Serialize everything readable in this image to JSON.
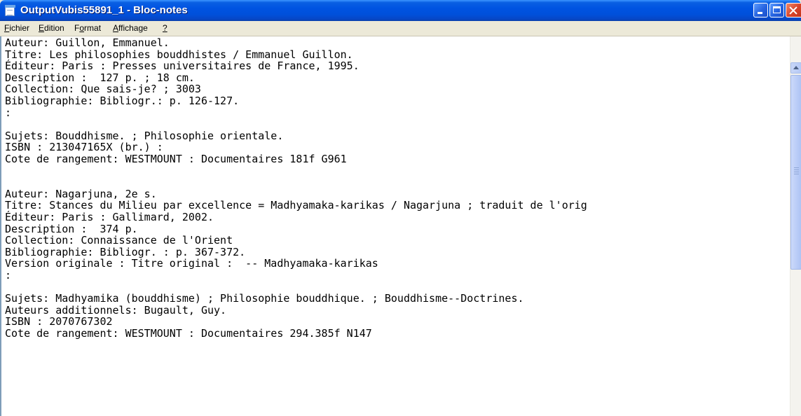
{
  "window": {
    "title": "OutputVubis55891_1 - Bloc-notes",
    "icon": "notepad-icon",
    "buttons": [
      "minimize-button",
      "maximize-button",
      "close-button"
    ]
  },
  "menu": {
    "items": [
      {
        "label": "Fichier",
        "mnemonic": "F"
      },
      {
        "label": "Edition",
        "mnemonic": "E"
      },
      {
        "label": "Format",
        "mnemonic": "o"
      },
      {
        "label": "Affichage",
        "mnemonic": "A"
      },
      {
        "label": "?",
        "mnemonic": "?"
      }
    ]
  },
  "document": {
    "lines": [
      "Auteur: Guillon, Emmanuel.",
      "Titre: Les philosophies bouddhistes / Emmanuel Guillon.",
      "Éditeur: Paris : Presses universitaires de France, 1995.",
      "Description :  127 p. ; 18 cm.",
      "Collection: Que sais-je? ; 3003",
      "Bibliographie: Bibliogr.: p. 126-127.",
      ":",
      "",
      "Sujets: Bouddhisme. ; Philosophie orientale.",
      "ISBN : 213047165X (br.) :",
      "Cote de rangement: WESTMOUNT : Documentaires 181f G961",
      "",
      "",
      "Auteur: Nagarjuna, 2e s.",
      "Titre: Stances du Milieu par excellence = Madhyamaka-karikas / Nagarjuna ; traduit de l'orig",
      "Éditeur: Paris : Gallimard, 2002.",
      "Description :  374 p.",
      "Collection: Connaissance de l'Orient",
      "Bibliographie: Bibliogr. : p. 367-372.",
      "Version originale : Titre original :  -- Madhyamaka-karikas",
      ":",
      "",
      "Sujets: Madhyamika (bouddhisme) ; Philosophie bouddhique. ; Bouddhisme--Doctrines.",
      "Auteurs additionnels: Bugault, Guy.",
      "ISBN : 2070767302",
      "Cote de rangement: WESTMOUNT : Documentaires 294.385f N147"
    ]
  },
  "colors": {
    "titlebar": "#0053E1",
    "menubar": "#ECE9D8",
    "editor_bg": "#FFFFFF",
    "close_button": "#D8442A"
  }
}
